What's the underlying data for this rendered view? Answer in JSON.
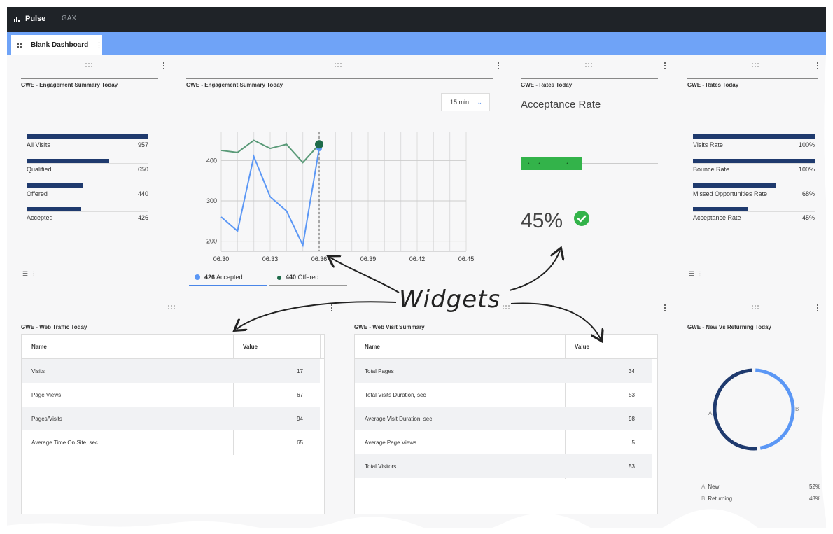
{
  "app": {
    "name": "Pulse",
    "section": "GAX"
  },
  "tab": {
    "label": "Blank Dashboard"
  },
  "widgets": {
    "w1": {
      "title": "GWE - Engagement Summary Today",
      "bars": [
        {
          "label": "All Visits",
          "value": "957",
          "fill": 1.0
        },
        {
          "label": "Qualified",
          "value": "650",
          "fill": 0.68
        },
        {
          "label": "Offered",
          "value": "440",
          "fill": 0.46
        },
        {
          "label": "Accepted",
          "value": "426",
          "fill": 0.45
        }
      ]
    },
    "w2": {
      "title": "GWE - Engagement Summary Today",
      "interval": "15 min",
      "legend": [
        {
          "value": "426",
          "label": "Accepted",
          "color": "#5b97f5"
        },
        {
          "value": "440",
          "label": "Offered",
          "color": "#1e6b4a"
        }
      ]
    },
    "w3": {
      "title": "GWE - Rates Today",
      "metric": "Acceptance Rate",
      "percent": "45%",
      "fill": 0.45
    },
    "w4": {
      "title": "GWE - Rates Today",
      "bars": [
        {
          "label": "Visits Rate",
          "value": "100%",
          "fill": 1.0
        },
        {
          "label": "Bounce Rate",
          "value": "100%",
          "fill": 1.0
        },
        {
          "label": "Missed Opportunities Rate",
          "value": "68%",
          "fill": 0.68
        },
        {
          "label": "Acceptance Rate",
          "value": "45%",
          "fill": 0.45
        }
      ]
    },
    "w5": {
      "title": "GWE - Web Traffic Today",
      "col_name": "Name",
      "col_value": "Value",
      "rows": [
        {
          "name": "Visits",
          "value": "17"
        },
        {
          "name": "Page Views",
          "value": "67"
        },
        {
          "name": "Pages/Visits",
          "value": "94"
        },
        {
          "name": "Average Time On Site, sec",
          "value": "65"
        }
      ]
    },
    "w6": {
      "title": "GWE - Web Visit Summary",
      "col_name": "Name",
      "col_value": "Value",
      "rows": [
        {
          "name": "Total Pages",
          "value": "34"
        },
        {
          "name": "Total Visits Duration, sec",
          "value": "53"
        },
        {
          "name": "Average Visit Duration, sec",
          "value": "98"
        },
        {
          "name": "Average Page Views",
          "value": "5"
        },
        {
          "name": "Total Visitors",
          "value": "53"
        }
      ]
    },
    "w7": {
      "title": "GWE - New Vs Returning Today",
      "label_a": "A",
      "label_b": "B",
      "legend": [
        {
          "key": "A",
          "label": "New",
          "value": "52%"
        },
        {
          "key": "B",
          "label": "Returning",
          "value": "48%"
        }
      ]
    }
  },
  "chart_data": {
    "type": "line",
    "x": [
      "06:30",
      "06:31",
      "06:32",
      "06:33",
      "06:34",
      "06:35",
      "06:36"
    ],
    "x_ticks": [
      "06:30",
      "06:33",
      "06:36",
      "06:39",
      "06:42",
      "06:45"
    ],
    "y_ticks": [
      "200",
      "300",
      "400"
    ],
    "ylim": [
      175,
      470
    ],
    "series": [
      {
        "name": "Accepted",
        "color": "#5b97f5",
        "values": [
          260,
          225,
          410,
          310,
          275,
          190,
          430
        ]
      },
      {
        "name": "Offered",
        "color": "#5a9a78",
        "values": [
          425,
          420,
          450,
          430,
          440,
          395,
          440
        ]
      }
    ]
  },
  "donut_data": {
    "type": "pie",
    "categories": [
      "New",
      "Returning"
    ],
    "values": [
      52,
      48
    ],
    "colors": [
      "#1f3a6e",
      "#5b97f5"
    ]
  },
  "annotation": {
    "text": "Widgets"
  }
}
